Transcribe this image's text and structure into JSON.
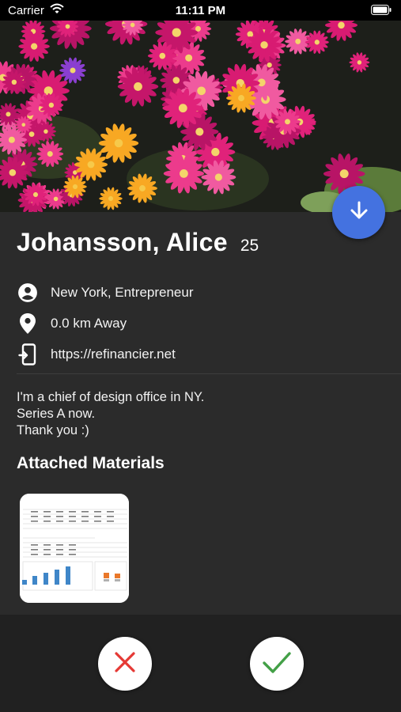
{
  "status_bar": {
    "carrier": "Carrier",
    "time": "11:11 PM"
  },
  "profile": {
    "name": "Johansson, Alice",
    "age": "25",
    "location_job": "New York,  Entrepreneur",
    "distance": "0.0 km Away",
    "website": "https://refinancier.net",
    "bio": [
      "I'm a chief of design office in NY.",
      "Series A now.",
      "Thank you :)"
    ]
  },
  "attachments": {
    "title": "Attached Materials"
  },
  "icons": {
    "fab": "arrow-down-icon",
    "person": "account-circle-icon",
    "location": "location-pin-icon",
    "link": "phone-link-icon",
    "reject": "close-icon",
    "accept": "checkmark-icon"
  },
  "colors": {
    "fab": "#4472e0",
    "reject": "#e53935",
    "accept": "#43a047",
    "background": "#2b2b2b"
  }
}
